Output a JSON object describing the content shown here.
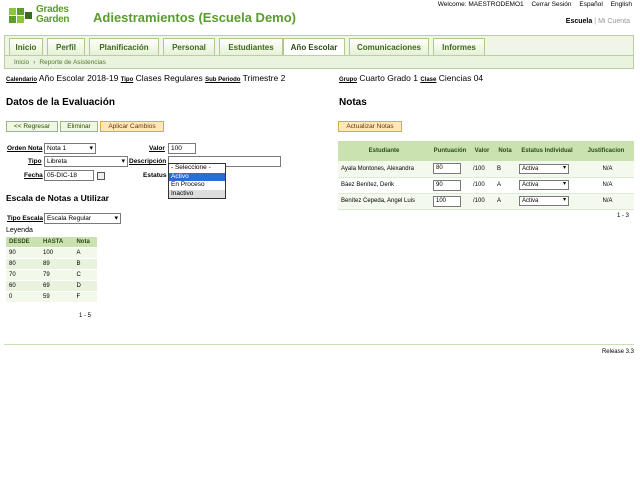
{
  "header": {
    "logo_line1": "Grades",
    "logo_line2": "Garden",
    "school_title": "Adiestramientos (Escuela Demo)",
    "welcome": "Welcome: MAESTRODEMO1",
    "logout": "Cerrar Sesión",
    "lang_es": "Español",
    "lang_en": "English",
    "tab_school": "Escuela",
    "tab_account": "Mi Cuenta"
  },
  "nav": {
    "tabs": [
      "Inicio",
      "Perfil",
      "Planificación",
      "Personal",
      "Estudiantes",
      "Año Escolar",
      "Comunicaciones",
      "Informes"
    ],
    "active": "Año Escolar"
  },
  "breadcrumb": {
    "home": "Inicio",
    "current": "Reporte de Asistencias"
  },
  "context": {
    "calendar_label": "Calendario",
    "calendar_value": "Año Escolar 2018-19",
    "type_label": "Tipo",
    "type_value": "Clases Regulares",
    "subperiod_label": "Sub Periodo",
    "subperiod_value": "Trimestre 2",
    "group_label": "Grupo",
    "group_value": "Cuarto Grado 1",
    "class_label": "Clase",
    "class_value": "Ciencias 04"
  },
  "evaluation": {
    "title": "Datos de la Evaluación",
    "back_button": "<< Regresar",
    "delete_button": "Eliminar",
    "apply_button": "Aplicar Cambios",
    "order_label": "Orden Nota",
    "order_value": "Nota 1",
    "value_label": "Valor",
    "value_value": "100",
    "type_label": "Tipo",
    "type_value": "Libreta",
    "description_label": "Descripción",
    "description_value": "",
    "date_label": "Fecha",
    "date_value": "05-DIC-18",
    "status_label": "Estatus",
    "status_options": [
      "- Seleccione -",
      "Activo",
      "En Proceso",
      "Inactivo"
    ],
    "status_selected": "Activo"
  },
  "scale": {
    "title": "Escala de Notas a Utilizar",
    "type_label": "Tipo Escala",
    "type_value": "Escala Regular",
    "legend": "Leyenda",
    "headers": [
      "DESDE",
      "HASTA",
      "Nota"
    ],
    "rows": [
      [
        "90",
        "100",
        "A"
      ],
      [
        "80",
        "89",
        "B"
      ],
      [
        "70",
        "79",
        "C"
      ],
      [
        "60",
        "69",
        "D"
      ],
      [
        "0",
        "59",
        "F"
      ]
    ],
    "pager": "1 - 5"
  },
  "notas": {
    "title": "Notas",
    "update_button": "Actualizar Notas",
    "headers": [
      "Estudiante",
      "Puntuación",
      "Valor",
      "Nota",
      "Estatus Individual",
      "Justificacion"
    ],
    "rows": [
      {
        "student": "Ayala Montones, Alexandra",
        "score": "80",
        "value": "/100",
        "grade": "B",
        "status": "Activa",
        "just": "N/A"
      },
      {
        "student": "Báez Benítez, Derik",
        "score": "90",
        "value": "/100",
        "grade": "A",
        "status": "Activa",
        "just": "N/A"
      },
      {
        "student": "Benítez Cepeda, Angel Luis",
        "score": "100",
        "value": "/100",
        "grade": "A",
        "status": "Activa",
        "just": "N/A"
      }
    ],
    "pager": "1 - 3"
  },
  "footer": {
    "release": "Release 3.3"
  }
}
